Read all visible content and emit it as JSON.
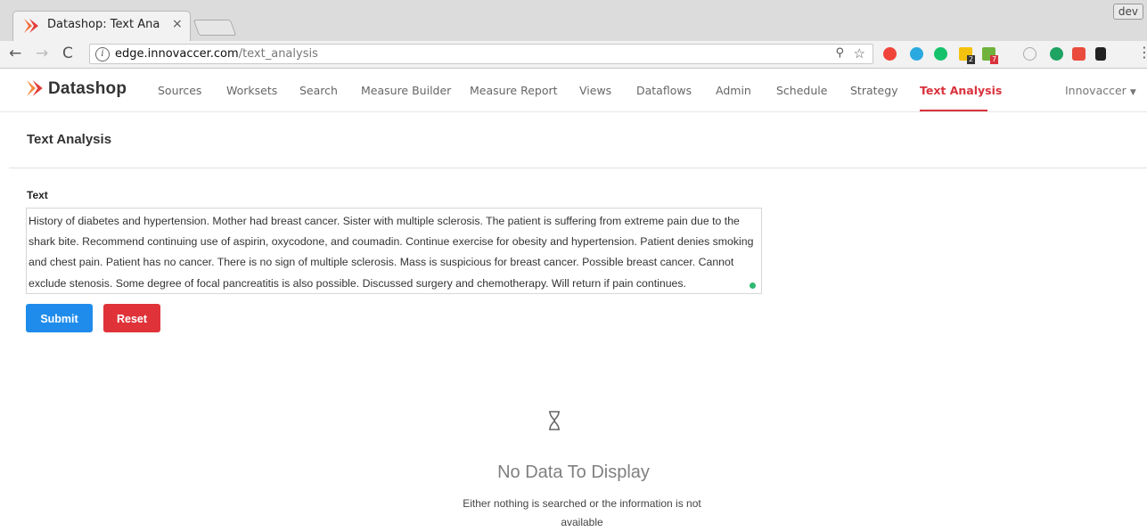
{
  "browser": {
    "tab_title": "Datashop: Text Ana",
    "tab_close": "×",
    "profile": "dev",
    "url_host": "edge.innovaccer.com",
    "url_path": "/text_analysis",
    "ext_badge_1": "2",
    "ext_badge_2": "7"
  },
  "app": {
    "brand": "Datashop",
    "nav": [
      "Sources",
      "Worksets",
      "Search",
      "Measure Builder",
      "Measure Report",
      "Views",
      "Dataflows",
      "Admin",
      "Schedule",
      "Strategy",
      "Text Analysis"
    ],
    "active_nav": "Text Analysis",
    "org": "Innovaccer",
    "accent": "#d9323c"
  },
  "page": {
    "title": "Text Analysis",
    "field_label": "Text",
    "text_value": "History of diabetes and hypertension. Mother had breast cancer. Sister with multiple sclerosis. The patient is suffering from extreme pain due to the shark bite. Recommend continuing use of aspirin, oxycodone, and coumadin. Continue exercise for obesity and hypertension. Patient denies smoking and chest pain. Patient has no cancer. There is no sign of multiple sclerosis. Mass is suspicious for breast cancer. Possible breast cancer. Cannot exclude stenosis. Some degree of focal pancreatitis is also possible. Discussed surgery and chemotherapy. Will return if pain continues.",
    "submit_label": "Submit",
    "reset_label": "Reset",
    "submit_color": "#1f8ceb",
    "reset_color": "#df3339"
  },
  "empty_state": {
    "icon": "hourglass-icon",
    "title": "No Data To Display",
    "subtitle": "Either nothing is searched or the information is not available"
  }
}
